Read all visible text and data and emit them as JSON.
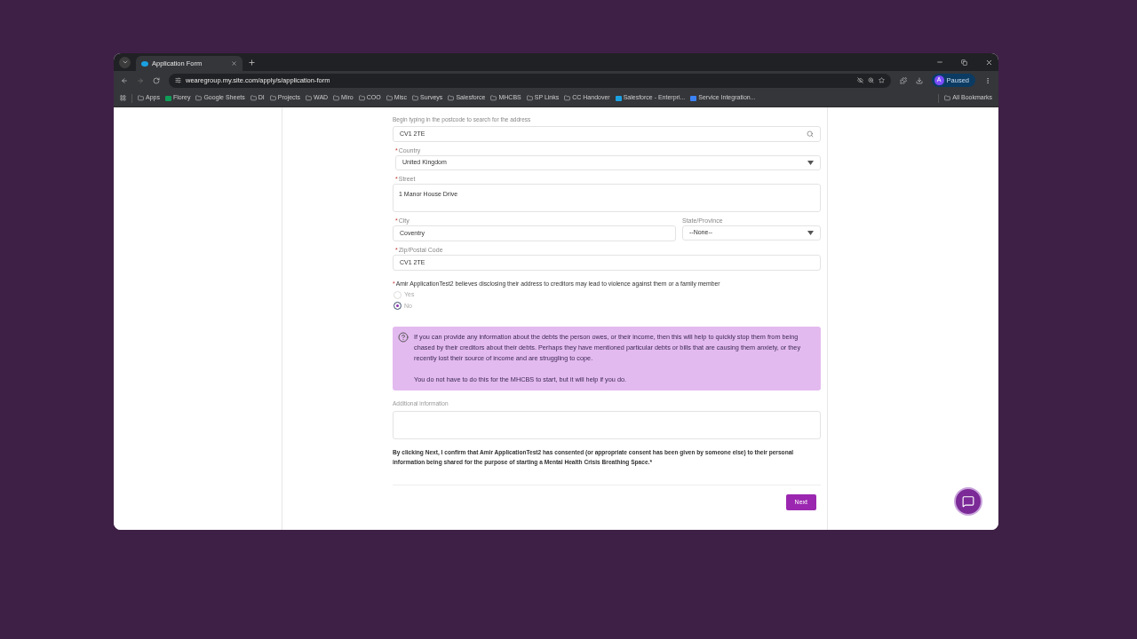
{
  "browser": {
    "tab": {
      "title": "Application Form",
      "selected": true
    },
    "url": "wearegroup.my.site.com/apply/s/application-form",
    "profile": {
      "initial": "A",
      "status": "Paused"
    },
    "bookmarks": [
      {
        "kind": "folder",
        "label": "Apps"
      },
      {
        "kind": "app",
        "label": "Florey",
        "color": "#0f9d58"
      },
      {
        "kind": "folder",
        "label": "Google Sheets"
      },
      {
        "kind": "folder",
        "label": "DI"
      },
      {
        "kind": "folder",
        "label": "Projects"
      },
      {
        "kind": "folder",
        "label": "WAD"
      },
      {
        "kind": "folder",
        "label": "Miro"
      },
      {
        "kind": "folder",
        "label": "COO"
      },
      {
        "kind": "folder",
        "label": "Misc"
      },
      {
        "kind": "folder",
        "label": "Surveys"
      },
      {
        "kind": "folder",
        "label": "Salesforce"
      },
      {
        "kind": "folder",
        "label": "MHCBS"
      },
      {
        "kind": "folder",
        "label": "SP Links"
      },
      {
        "kind": "folder",
        "label": "CC Handover"
      },
      {
        "kind": "app",
        "label": "Salesforce - Enterpri...",
        "color": "#1ba1e2"
      },
      {
        "kind": "app",
        "label": "Service Integration...",
        "color": "#3b82f6"
      }
    ],
    "all_bookmarks": "All Bookmarks"
  },
  "form": {
    "required_marker": "*",
    "postcode_hint": "Begin typing in the postcode to search for the address",
    "postcode": "CV1 2TE",
    "fields": [
      {
        "kind": "select",
        "label": "Country",
        "required": true,
        "value": "United Kingdom"
      },
      {
        "kind": "textarea",
        "label": "Street",
        "required": true,
        "value": "1 Manor House Drive"
      }
    ],
    "city": {
      "label": "City",
      "required": true,
      "value": "Coventry"
    },
    "state": {
      "label": "State/Province",
      "required": false,
      "value": "--None--"
    },
    "zip": {
      "label": "Zip/Postal Code",
      "required": true,
      "value": "CV1 2TE"
    },
    "question": {
      "text": "Amir ApplicationTest2 believes disclosing their address to creditors may lead to violence against them or a family member",
      "required": true,
      "options": [
        {
          "label": "Yes",
          "selected": false
        },
        {
          "label": "No",
          "selected": true
        }
      ]
    },
    "info": [
      "If you can provide any information about the debts the person owes, or their income, then this will help to quickly stop them from being chased by their creditors about their debts. Perhaps they have mentioned particular debts or bills that are causing them anxiety, or they recently lost their source of income and are struggling to cope.",
      "You do not have to do this for the MHCBS to start, but it will help if you do."
    ],
    "additional_label": "Additional information",
    "consent": "By clicking Next, I confirm that Amir ApplicationTest2 has consented (or appropriate consent has been given by someone else) to their personal information being shared for the purpose of starting a Mental Health Crisis Breathing Space.*",
    "next": "Next"
  }
}
